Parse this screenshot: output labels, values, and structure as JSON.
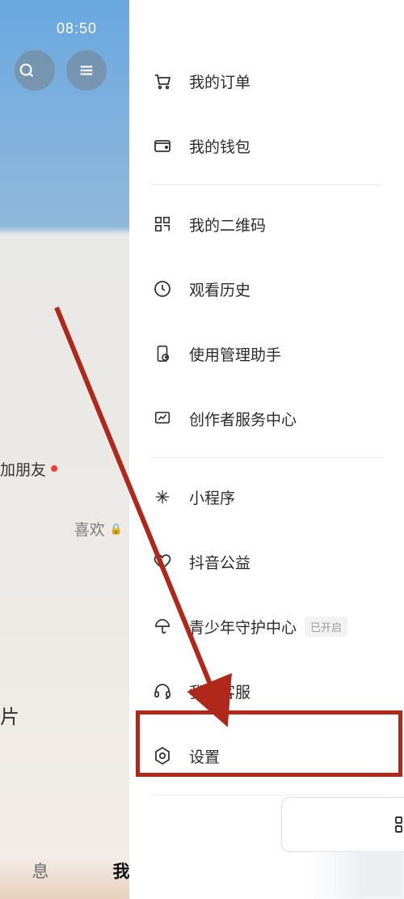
{
  "status": {
    "time": "08:50"
  },
  "left": {
    "add_friend": "加朋友",
    "likes": "喜欢",
    "card_suffix": "片",
    "nav_messages": "息",
    "nav_me": "我"
  },
  "drawer": {
    "items": [
      {
        "key": "orders",
        "label": "我的订单"
      },
      {
        "key": "wallet",
        "label": "我的钱包"
      },
      {
        "key": "qrcode",
        "label": "我的二维码"
      },
      {
        "key": "history",
        "label": "观看历史"
      },
      {
        "key": "usage",
        "label": "使用管理助手"
      },
      {
        "key": "creator",
        "label": "创作者服务中心"
      },
      {
        "key": "miniapp",
        "label": "小程序"
      },
      {
        "key": "charity",
        "label": "抖音公益"
      },
      {
        "key": "teen",
        "label": "青少年守护中心",
        "badge": "已开启"
      },
      {
        "key": "support",
        "label": "我的客服"
      },
      {
        "key": "settings",
        "label": "设置"
      }
    ]
  }
}
